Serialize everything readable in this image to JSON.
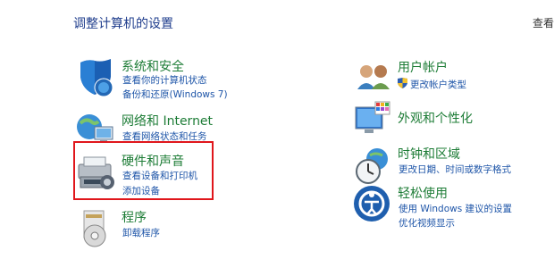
{
  "header": {
    "title": "调整计算机的设置",
    "view_by": "查看"
  },
  "left_column": [
    {
      "title": "系统和安全",
      "links": [
        "查看你的计算机状态",
        "备份和还原(Windows 7)"
      ],
      "icon": "shield-icon"
    },
    {
      "title": "网络和 Internet",
      "links": [
        "查看网络状态和任务"
      ],
      "icon": "network-globe-icon"
    },
    {
      "title": "硬件和声音",
      "links": [
        "查看设备和打印机",
        "添加设备"
      ],
      "icon": "printer-speaker-icon"
    },
    {
      "title": "程序",
      "links": [
        "卸载程序"
      ],
      "icon": "programs-disc-icon"
    }
  ],
  "right_column": [
    {
      "title": "用户帐户",
      "links": [
        "更改帐户类型"
      ],
      "icon": "users-icon"
    },
    {
      "title": "外观和个性化",
      "links": [],
      "icon": "monitor-palette-icon"
    },
    {
      "title": "时钟和区域",
      "links": [
        "更改日期、时间或数字格式"
      ],
      "icon": "clock-globe-icon"
    },
    {
      "title": "轻松使用",
      "links": [
        "使用 Windows 建议的设置",
        "优化视频显示"
      ],
      "icon": "ease-of-access-icon"
    }
  ],
  "colors": {
    "title_blue": "#1e3c8c",
    "category_green": "#1d7c36",
    "link_blue": "#1e55a8",
    "highlight_red": "#e0161b"
  }
}
